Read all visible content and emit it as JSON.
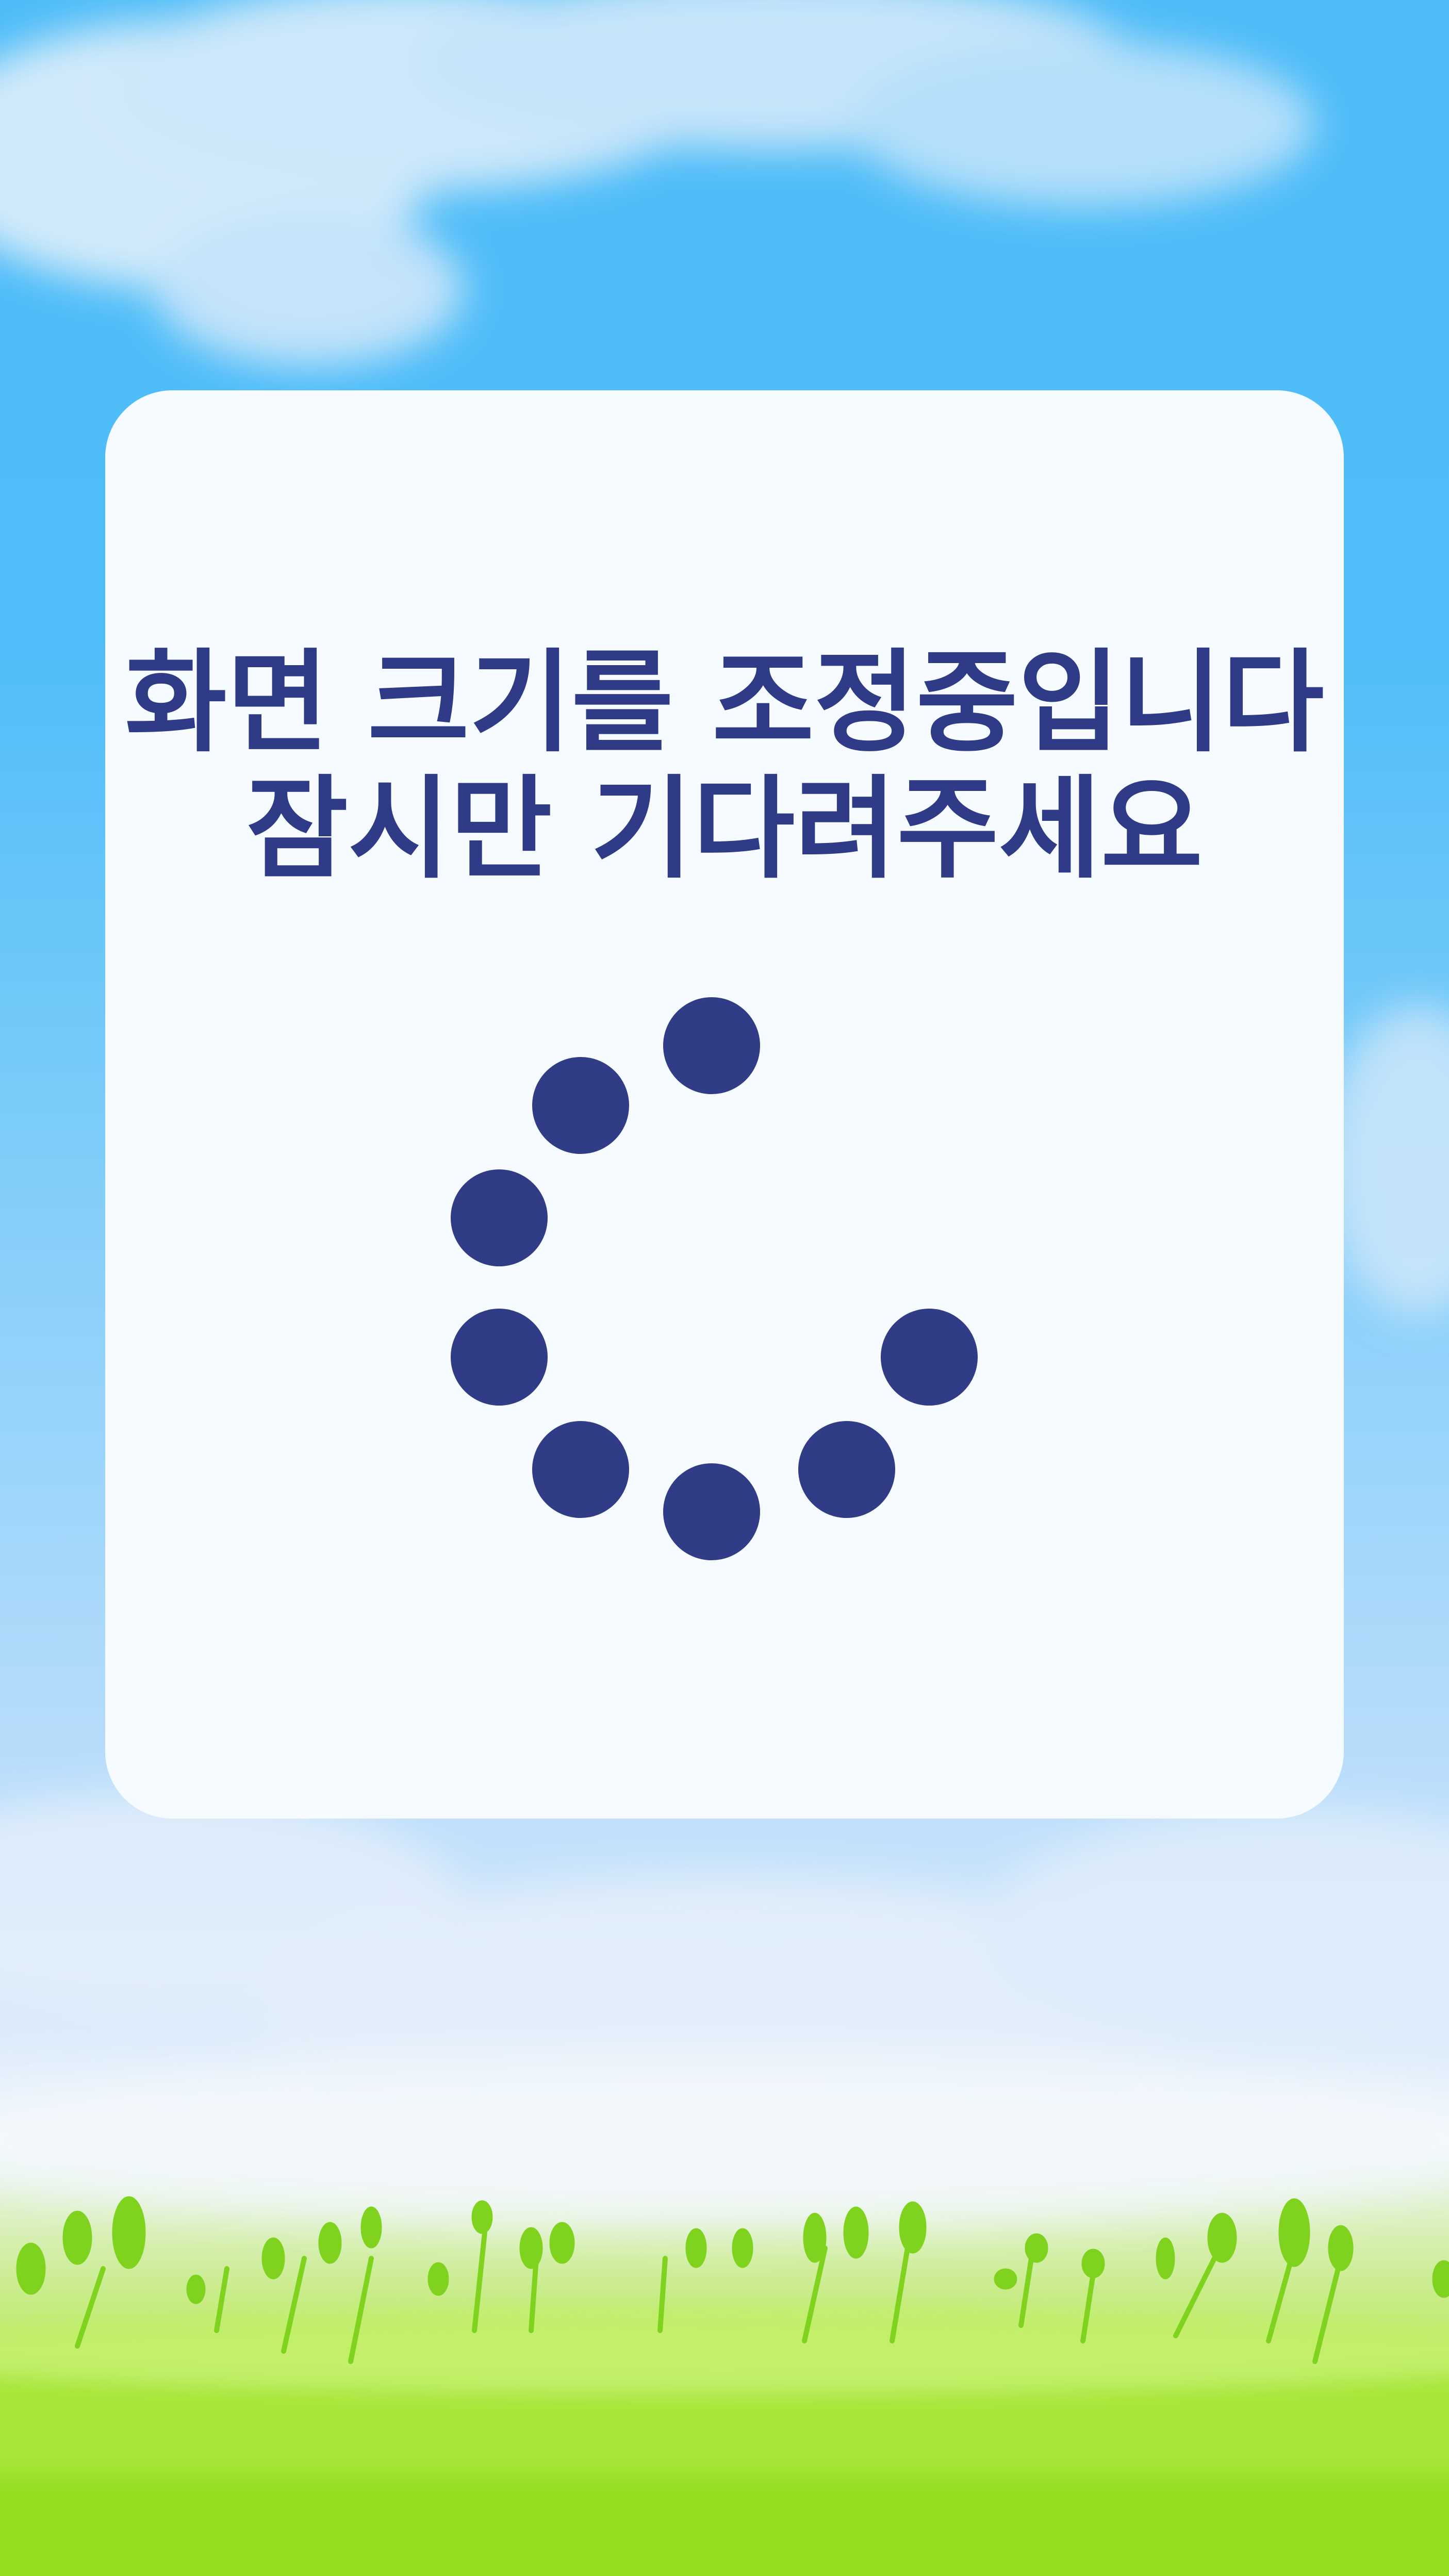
{
  "loading": {
    "title_line1": "화면 크기를 조정중입니다",
    "title_line2": "잠시만 기다려주세요"
  },
  "colors": {
    "sky_top": "#4dbcf7",
    "panel_background": "#f6fbff",
    "text": "#2f3b87",
    "spinner_dot": "#303c85",
    "grass": "#9ee42c"
  },
  "spinner": {
    "visible_dots": 8,
    "total_positions": 9
  }
}
